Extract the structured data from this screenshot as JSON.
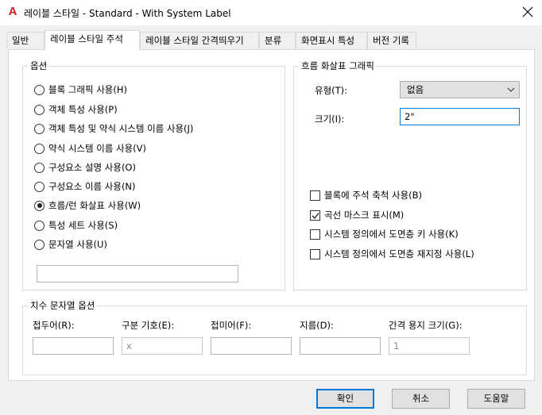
{
  "window": {
    "title": "레이블 스타일 - Standard - With System Label",
    "app_icon_glyph": "A",
    "close_icon": "close-icon"
  },
  "tabs": [
    {
      "label": "일반"
    },
    {
      "label": "레이블 스타일 주석"
    },
    {
      "label": "레이블 스타일 간격띄우기"
    },
    {
      "label": "분류"
    },
    {
      "label": "화면표시 특성"
    },
    {
      "label": "버전 기록"
    }
  ],
  "options_group": {
    "title": "옵션",
    "radios": [
      {
        "label": "블록 그래픽 사용(H)",
        "checked": false
      },
      {
        "label": "객체 특성 사용(P)",
        "checked": false
      },
      {
        "label": "객체 특성 및 약식 시스템 이름 사용(J)",
        "checked": false
      },
      {
        "label": "약식 시스템 이름 사용(V)",
        "checked": false
      },
      {
        "label": "구성요소 설명 사용(O)",
        "checked": false
      },
      {
        "label": "구성요소 이름 사용(N)",
        "checked": false
      },
      {
        "label": "흐름/런 화살표 사용(W)",
        "checked": true
      },
      {
        "label": "특성 세트 사용(S)",
        "checked": false
      },
      {
        "label": "문자열 사용(U)",
        "checked": false
      }
    ],
    "string_value": ""
  },
  "flow_group": {
    "title": "흐름 화살표 그래픽",
    "type_label": "유형(T):",
    "type_value": "없음",
    "size_label": "크기(I):",
    "size_value": "2\"",
    "checkboxes": [
      {
        "label": "블록에 주석 축척 사용(B)",
        "checked": false
      },
      {
        "label": "곡선 마스크 표시(M)",
        "checked": true
      },
      {
        "label": "시스템 정의에서 도면층 키 사용(K)",
        "checked": false
      },
      {
        "label": "시스템 정의에서 도면층 재지정 사용(L)",
        "checked": false
      }
    ]
  },
  "dimension_group": {
    "title": "치수 문자열 옵션",
    "fields": [
      {
        "label": "접두어(R):",
        "value": "",
        "disabled": false
      },
      {
        "label": "구분 기호(E):",
        "value": "x",
        "disabled": true
      },
      {
        "label": "접미어(F):",
        "value": "",
        "disabled": false
      },
      {
        "label": "지름(D):",
        "value": "",
        "disabled": false
      },
      {
        "label": "간격 용지 크기(G):",
        "value": "1",
        "disabled": true
      }
    ]
  },
  "buttons": {
    "ok": "확인",
    "cancel": "취소",
    "help": "도움말"
  }
}
